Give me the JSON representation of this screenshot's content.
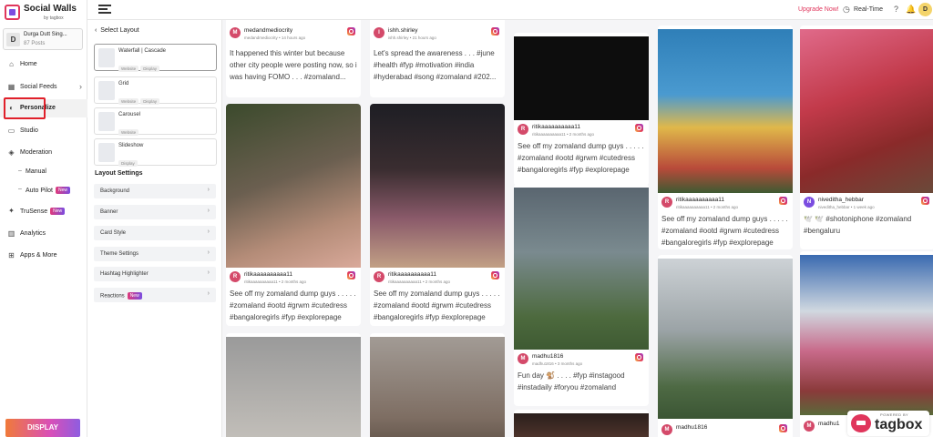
{
  "app": {
    "title": "Social Walls",
    "subtitle": "by tagbox"
  },
  "wall": {
    "avatar": "D",
    "name": "Durga Dutt Sing...",
    "posts": "87 Posts"
  },
  "nav": {
    "home": "Home",
    "social_feeds": "Social Feeds",
    "personalize": "Personalize",
    "studio": "Studio",
    "moderation": "Moderation",
    "manual": "Manual",
    "auto_pilot": "Auto Pilot",
    "trusense": "TruSense",
    "analytics": "Analytics",
    "apps_more": "Apps & More",
    "new_badge": "New",
    "display": "DISPLAY"
  },
  "topbar": {
    "upgrade": "Upgrade Now!",
    "realtime": "Real-Time",
    "avatar": "D"
  },
  "panel": {
    "back_label": "Select Layout",
    "layouts": [
      {
        "name": "Waterfall | Cascade",
        "tags": [
          "Website",
          "Display"
        ]
      },
      {
        "name": "Grid",
        "tags": [
          "Website",
          "Display"
        ]
      },
      {
        "name": "Carousel",
        "tags": [
          "Website"
        ]
      },
      {
        "name": "Slideshow",
        "tags": [
          "Display"
        ]
      }
    ],
    "settings_title": "Layout Settings",
    "settings": [
      "Background",
      "Banner",
      "Card Style",
      "Theme Settings",
      "Hashtag Highlighter",
      "Reactions"
    ],
    "reactions_badge": "New"
  },
  "posts": [
    {
      "avatar": "M",
      "user": "medandmediocrity",
      "meta": "medandmediocrity  •  14 hours ago",
      "text": "It happened this winter but because other city people were posting now, so i was having FOMO . . . #zomaland..."
    },
    {
      "avatar": "I",
      "user": "ishh.shirley",
      "meta": "ishh.shirley  •  21 hours ago",
      "text": "Let's spread the awareness . . . #june #health #fyp #motivation #india #hyderabad #song #zomaland #202..."
    },
    {
      "avatar": "R",
      "user": "ritikaaaaaaaaaa11",
      "meta": "ritikaaaaaaaaaa11  •  2 months ago",
      "text": "See off my zomaland dump guys . . . . . #zomaland #ootd #grwm #cutedress #bangaloregirls #fyp #explorepage"
    },
    {
      "avatar": "R",
      "user": "ritikaaaaaaaaaa11",
      "meta": "ritikaaaaaaaaaa11  •  2 months ago",
      "text": "See off my zomaland dump guys . . . . . #zomaland #ootd #grwm #cutedress #bangaloregirls #fyp #explorepage"
    },
    {
      "avatar": "R",
      "user": "ritikaaaaaaaaaa11",
      "meta": "ritikaaaaaaaaaa11  •  2 months ago",
      "text": "See off my zomaland dump guys . . . . . #zomaland #ootd #grwm #cutedress #bangaloregirls #fyp #explorepage"
    },
    {
      "avatar": "M",
      "user": "madhu1816",
      "meta": "madhu1816  •  3 months ago",
      "text": "Fun day 🐒 . . . . #fyp #instagood #instadaily #foryou #zomaland"
    },
    {
      "avatar": "R",
      "user": "ritikaaaaaaaaaa11",
      "meta": "ritikaaaaaaaaaa11  •  2 months ago",
      "text": "See off my zomaland dump guys . . . . . #zomaland #ootd #grwm #cutedress #bangaloregirls #fyp #explorepage"
    },
    {
      "avatar": "N",
      "user": "niveditha_hebbar",
      "meta": "niveditha_hebbar  •  1 week ago",
      "text": "🕊️ 🕊️ #shotoniphone #zomaland #bengaluru"
    },
    {
      "avatar": "M",
      "user": "madhu1816",
      "meta": "",
      "text": ""
    },
    {
      "avatar": "M",
      "user": "madhu1",
      "meta": "",
      "text": ""
    }
  ],
  "brand": {
    "powered": "POWERED BY",
    "name": "tagbox"
  },
  "colors": {
    "accent": "#e0365c",
    "highlight": "#e0202a",
    "feed_bg": "#f5f5f7"
  }
}
